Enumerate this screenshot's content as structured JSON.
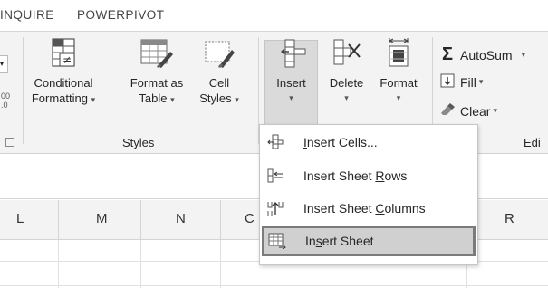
{
  "tabs": [
    {
      "label": "INQUIRE"
    },
    {
      "label": "POWERPIVOT"
    }
  ],
  "ribbon": {
    "styles_group": {
      "label": "Styles",
      "conditional_formatting": {
        "line1": "Conditional",
        "line2": "Formatting",
        "icon": "conditional-formatting-icon"
      },
      "format_as_table": {
        "line1": "Format as",
        "line2": "Table",
        "icon": "format-as-table-icon"
      },
      "cell_styles": {
        "line1": "Cell",
        "line2": "Styles",
        "icon": "cell-styles-icon"
      }
    },
    "cells_group": {
      "insert": {
        "label": "Insert",
        "icon": "insert-cells-icon",
        "active": true
      },
      "delete": {
        "label": "Delete",
        "icon": "delete-cells-icon"
      },
      "format": {
        "label": "Format",
        "icon": "format-cells-icon"
      }
    },
    "editing_group": {
      "label": "Edi",
      "autosum": {
        "label": "AutoSum",
        "icon": "sigma-icon"
      },
      "fill": {
        "label": "Fill",
        "icon": "fill-down-icon"
      },
      "clear": {
        "label": "Clear",
        "icon": "eraser-icon"
      }
    },
    "number_fragment": {
      "text1": "00",
      "text2": ".0"
    }
  },
  "columns": [
    "L",
    "M",
    "N",
    "C",
    "R"
  ],
  "insert_menu": {
    "items": [
      {
        "pre": "",
        "ul": "I",
        "post": "nsert Cells...",
        "icon": "insert-cells-icon"
      },
      {
        "pre": "Insert Sheet ",
        "ul": "R",
        "post": "ows",
        "icon": "insert-rows-icon"
      },
      {
        "pre": "Insert Sheet ",
        "ul": "C",
        "post": "olumns",
        "icon": "insert-columns-icon"
      },
      {
        "pre": "In",
        "ul": "s",
        "post": "ert Sheet",
        "icon": "insert-sheet-icon",
        "highlighted": true
      }
    ]
  }
}
